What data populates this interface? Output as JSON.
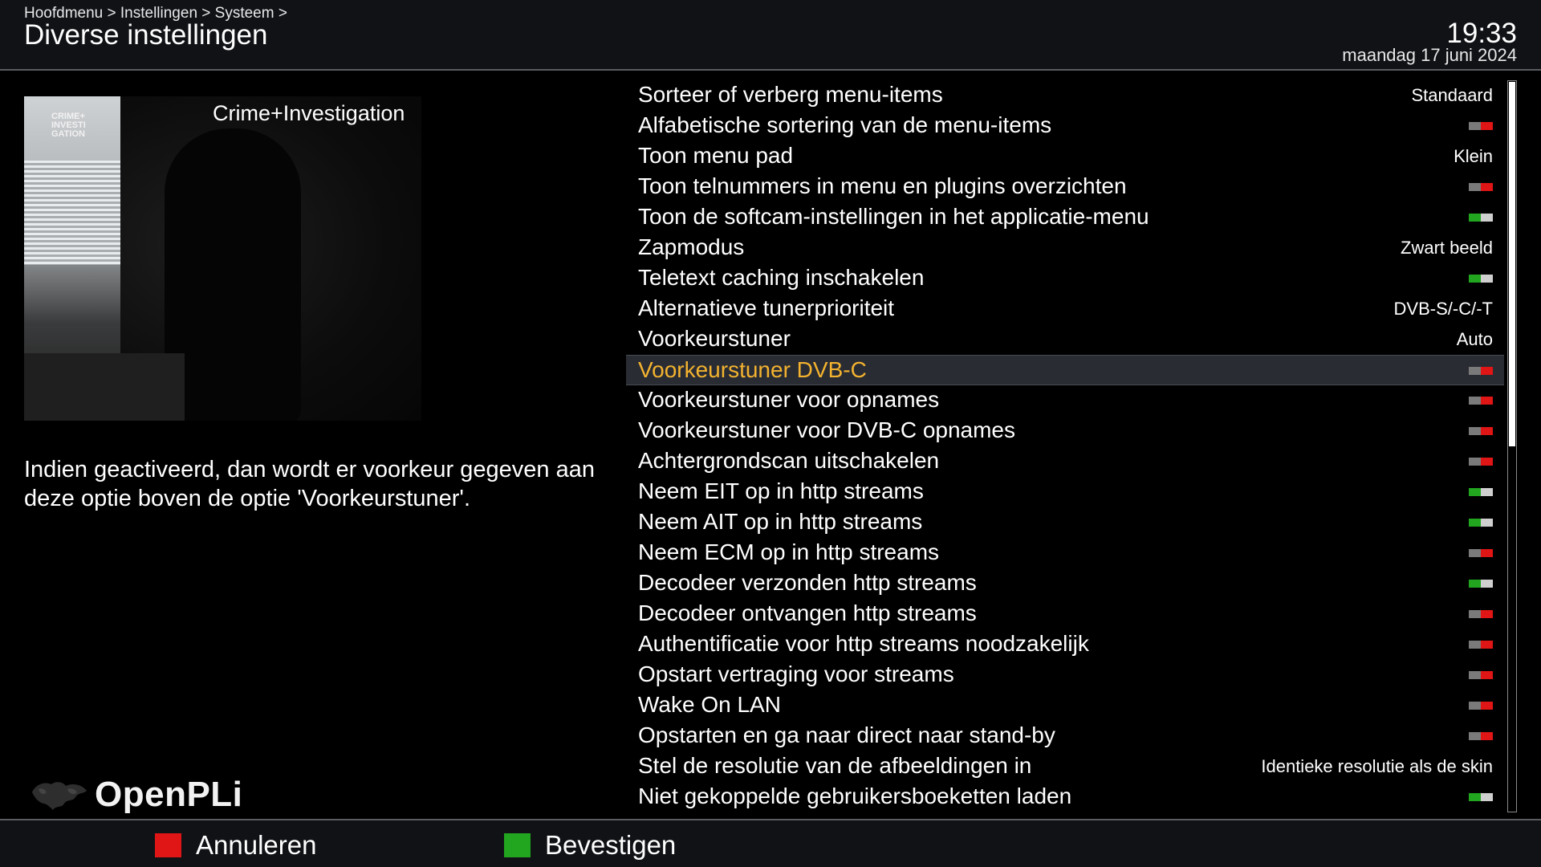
{
  "header": {
    "breadcrumb": "Hoofdmenu > Instellingen > Systeem >",
    "title": "Diverse instellingen",
    "time": "19:33",
    "date": "maandag 17 juni 2024"
  },
  "preview": {
    "channel": "Crime+Investigation",
    "logo": "CRIME+ INVESTI GATION"
  },
  "help_text": "Indien geactiveerd, dan wordt er voorkeur gegeven aan deze optie boven de optie 'Voorkeurstuner'.",
  "brand": "OpenPLi",
  "settings": {
    "selected_index": 9,
    "items": [
      {
        "label": "Sorteer of verberg menu-items",
        "type": "text",
        "value": "Standaard"
      },
      {
        "label": "Alfabetische sortering van de menu-items",
        "type": "toggle",
        "state": "off"
      },
      {
        "label": "Toon menu pad",
        "type": "text",
        "value": "Klein"
      },
      {
        "label": "Toon telnummers in menu en plugins overzichten",
        "type": "toggle",
        "state": "off"
      },
      {
        "label": "Toon de softcam-instellingen in het applicatie-menu",
        "type": "toggle",
        "state": "on"
      },
      {
        "label": "Zapmodus",
        "type": "text",
        "value": "Zwart beeld"
      },
      {
        "label": "Teletext caching inschakelen",
        "type": "toggle",
        "state": "on"
      },
      {
        "label": "Alternatieve tunerprioriteit",
        "type": "text",
        "value": "DVB-S/-C/-T"
      },
      {
        "label": "Voorkeurstuner",
        "type": "text",
        "value": "Auto"
      },
      {
        "label": "Voorkeurstuner DVB-C",
        "type": "toggle",
        "state": "off"
      },
      {
        "label": "Voorkeurstuner voor opnames",
        "type": "toggle",
        "state": "off"
      },
      {
        "label": "Voorkeurstuner voor DVB-C opnames",
        "type": "toggle",
        "state": "off"
      },
      {
        "label": "Achtergrondscan uitschakelen",
        "type": "toggle",
        "state": "off"
      },
      {
        "label": "Neem EIT op in http streams",
        "type": "toggle",
        "state": "on"
      },
      {
        "label": "Neem AIT op in http streams",
        "type": "toggle",
        "state": "on"
      },
      {
        "label": "Neem ECM op in http streams",
        "type": "toggle",
        "state": "off"
      },
      {
        "label": "Decodeer verzonden http streams",
        "type": "toggle",
        "state": "on"
      },
      {
        "label": "Decodeer ontvangen http streams",
        "type": "toggle",
        "state": "off"
      },
      {
        "label": "Authentificatie voor http streams noodzakelijk",
        "type": "toggle",
        "state": "off"
      },
      {
        "label": "Opstart vertraging voor streams",
        "type": "toggle",
        "state": "off"
      },
      {
        "label": "Wake On LAN",
        "type": "toggle",
        "state": "off"
      },
      {
        "label": "Opstarten en ga naar direct naar stand-by",
        "type": "toggle",
        "state": "off"
      },
      {
        "label": "Stel de resolutie van de afbeeldingen in",
        "type": "text",
        "value": "Identieke resolutie als de skin"
      },
      {
        "label": "Niet gekoppelde gebruikersboeketten laden",
        "type": "toggle",
        "state": "on"
      }
    ]
  },
  "scroll_fraction": 0.5,
  "footer": {
    "red_label": "Annuleren",
    "green_label": "Bevestigen"
  },
  "colors": {
    "red_key": "#e01515",
    "green_key": "#22a51f",
    "selection_text": "#f3b32f",
    "selection_bg": "#2a2c33"
  }
}
